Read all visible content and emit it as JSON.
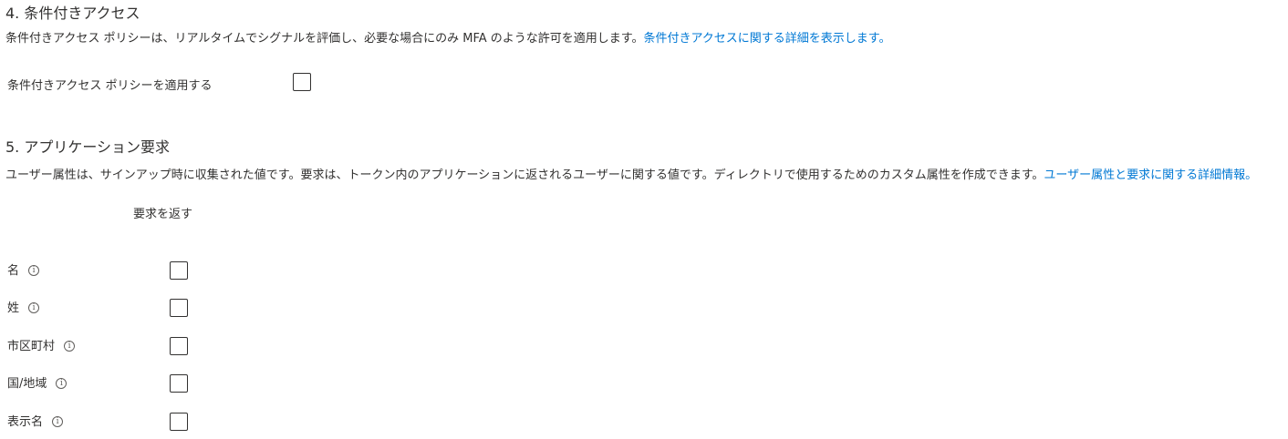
{
  "conditional_access": {
    "heading": "4. 条件付きアクセス",
    "description": "条件付きアクセス ポリシーは、リアルタイムでシグナルを評価し、必要な場合にのみ MFA のような許可を適用します。",
    "link": "条件付きアクセスに関する詳細を表示します。",
    "apply_label": "条件付きアクセス ポリシーを適用する"
  },
  "claims": {
    "heading": "5. アプリケーション要求",
    "description": "ユーザー属性は、サインアップ時に収集された値です。要求は、トークン内のアプリケーションに返されるユーザーに関する値です。ディレクトリで使用するためのカスタム属性を作成できます。",
    "link": "ユーザー属性と要求に関する詳細情報。",
    "column_header": "要求を返す",
    "info_glyph": "i",
    "attributes": [
      {
        "label": "名"
      },
      {
        "label": "姓"
      },
      {
        "label": "市区町村"
      },
      {
        "label": "国/地域"
      },
      {
        "label": "表示名"
      }
    ]
  }
}
